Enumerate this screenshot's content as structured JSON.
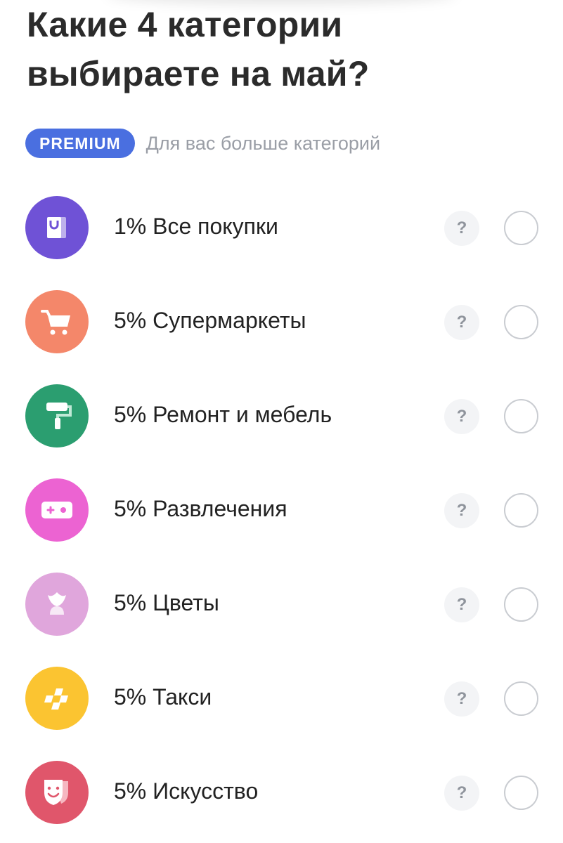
{
  "header": {
    "title": "Какие 4 категории выбираете на май?"
  },
  "premium": {
    "badge": "PREMIUM",
    "text": "Для вас больше категорий"
  },
  "help_symbol": "?",
  "categories": [
    {
      "label": "1% Все покупки",
      "color": "#6f52d6",
      "icon": "shopping-bag-icon"
    },
    {
      "label": "5% Супермаркеты",
      "color": "#f4876a",
      "icon": "shopping-cart-icon"
    },
    {
      "label": "5% Ремонт и мебель",
      "color": "#2b9e70",
      "icon": "paint-roller-icon"
    },
    {
      "label": "5% Развлечения",
      "color": "#ec63d2",
      "icon": "gamepad-icon"
    },
    {
      "label": "5% Цветы",
      "color": "#e0a6dc",
      "icon": "flower-icon"
    },
    {
      "label": "5% Такси",
      "color": "#fbc431",
      "icon": "taxi-checker-icon"
    },
    {
      "label": "5% Искусство",
      "color": "#e0566b",
      "icon": "theater-mask-icon"
    }
  ]
}
